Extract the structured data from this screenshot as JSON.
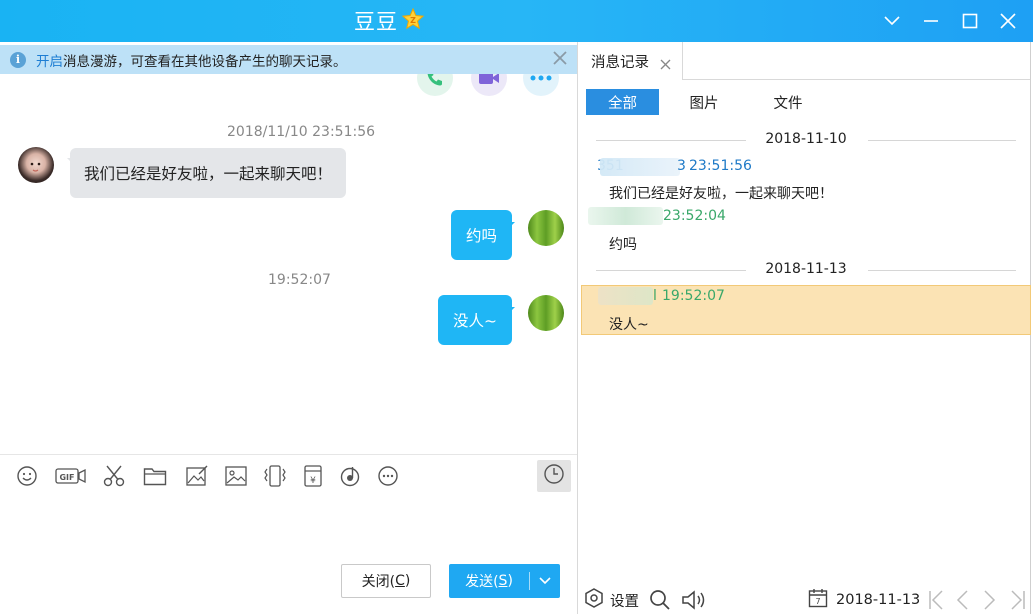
{
  "window": {
    "title": "豆豆",
    "badge_icon": "star-badge-icon",
    "controls": [
      "chevron-down-icon",
      "minimize-icon",
      "maximize-icon",
      "close-icon"
    ]
  },
  "notice": {
    "link": "开启",
    "text": "消息漫游，可查看在其他设备产生的聊天记录。"
  },
  "quick_actions": [
    "phone-icon",
    "video-icon",
    "more-icon"
  ],
  "chat": {
    "messages": [
      {
        "time": "2018/11/10 23:51:56",
        "direction": "in",
        "text": "我们已经是好友啦，一起来聊天吧！"
      },
      {
        "direction": "out",
        "text": "约吗"
      },
      {
        "time": "19:52:07",
        "direction": "out",
        "text": "没人~"
      }
    ]
  },
  "toolbar": {
    "tools": [
      "emoji-icon",
      "gif-icon",
      "screenshot-scissors-icon",
      "folder-icon",
      "image-edit-icon",
      "picture-icon",
      "vibrate-icon",
      "red-packet-icon",
      "music-icon",
      "more-circle-icon"
    ],
    "history_icon": "clock-icon"
  },
  "buttons": {
    "close_label": "关闭(",
    "close_key": "C",
    "close_tail": ")",
    "send_label": "发送(",
    "send_key": "S",
    "send_tail": ")"
  },
  "history_panel": {
    "tab_label": "消息记录",
    "filters": [
      "全部",
      "图片",
      "文件"
    ],
    "active_filter": "全部",
    "groups": [
      {
        "date": "2018-11-10",
        "records": [
          {
            "time": "23:51:56",
            "sender_prefix": "351",
            "sender_suffix": "3",
            "text": "我们已经是好友啦，一起来聊天吧！",
            "color": "#1f7ac7"
          },
          {
            "time": "23:52:04",
            "text": "约吗",
            "color": "#3aa86a"
          }
        ]
      },
      {
        "date": "2018-11-13",
        "records": [
          {
            "time": "19:52:07",
            "sender_suffix": "l",
            "text": "没人~",
            "color": "#3aa86a",
            "highlighted": true
          }
        ]
      }
    ],
    "footer": {
      "settings_label": "设置",
      "date": "2018-11-13"
    }
  }
}
